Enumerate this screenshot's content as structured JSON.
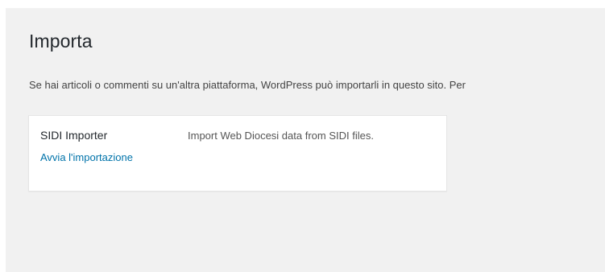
{
  "page": {
    "title": "Importa",
    "intro": "Se hai articoli o commenti su un'altra piattaforma, WordPress può importarli in questo sito. Per"
  },
  "importers": [
    {
      "name": "SIDI Importer",
      "action_label": "Avvia l'importazione",
      "description": "Import Web Diocesi data from SIDI files."
    }
  ],
  "colors": {
    "background": "#f1f1f1",
    "link": "#0073aa",
    "text": "#23282d"
  }
}
